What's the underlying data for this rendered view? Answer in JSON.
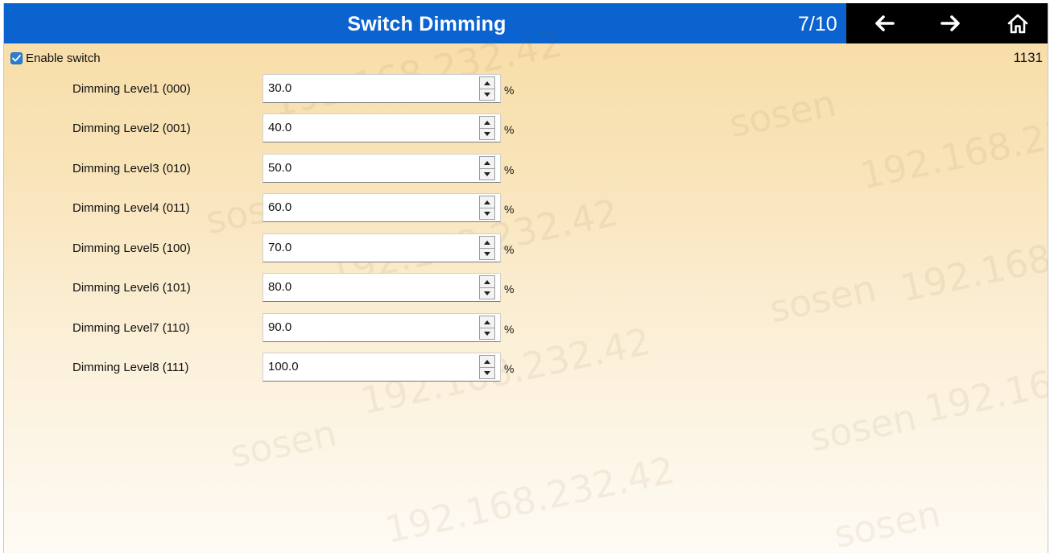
{
  "header": {
    "title": "Switch Dimming",
    "page_indicator": "7/10",
    "back_icon": "arrow-left-icon",
    "forward_icon": "arrow-right-icon",
    "home_icon": "home-icon",
    "background_color": "#0b63d0"
  },
  "enable_switch": {
    "label": "Enable switch",
    "checked": true
  },
  "corner_number": "1131",
  "dimming_levels": [
    {
      "label": "Dimming Level1 (000)",
      "value": "30.0",
      "unit": "%"
    },
    {
      "label": "Dimming Level2 (001)",
      "value": "40.0",
      "unit": "%"
    },
    {
      "label": "Dimming Level3 (010)",
      "value": "50.0",
      "unit": "%"
    },
    {
      "label": "Dimming Level4 (011)",
      "value": "60.0",
      "unit": "%"
    },
    {
      "label": "Dimming Level5 (100)",
      "value": "70.0",
      "unit": "%"
    },
    {
      "label": "Dimming Level6 (101)",
      "value": "80.0",
      "unit": "%"
    },
    {
      "label": "Dimming Level7 (110)",
      "value": "90.0",
      "unit": "%"
    },
    {
      "label": "Dimming Level8 (111)",
      "value": "100.0",
      "unit": "%"
    }
  ],
  "watermark": {
    "host": "192.168.232.42",
    "brand": "sosen"
  }
}
